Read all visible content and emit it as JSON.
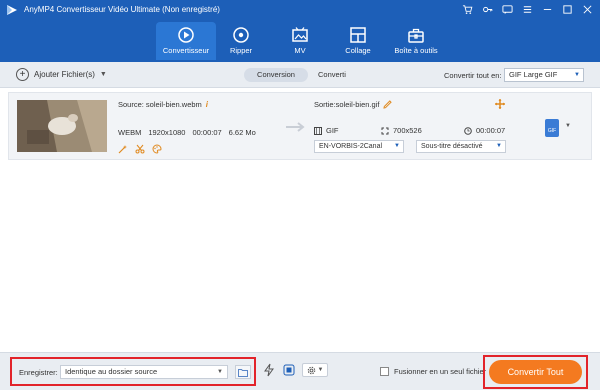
{
  "app": {
    "title": "AnyMP4 Convertisseur Vidéo Ultimate (Non enregistré)"
  },
  "window_icons": [
    "cart-icon",
    "key-icon",
    "chat-icon",
    "menu-icon",
    "minimize-icon",
    "maximize-icon",
    "close-icon"
  ],
  "nav": {
    "tabs": [
      {
        "label": "Convertisseur",
        "icon": "convert-icon",
        "active": true
      },
      {
        "label": "Ripper",
        "icon": "disc-icon",
        "active": false
      },
      {
        "label": "MV",
        "icon": "mv-icon",
        "active": false
      },
      {
        "label": "Collage",
        "icon": "collage-icon",
        "active": false
      },
      {
        "label": "Boîte à outils",
        "icon": "toolbox-icon",
        "active": false
      }
    ]
  },
  "toolbar": {
    "add_label": "Ajouter Fichier(s)",
    "tab_converting": "Conversion",
    "tab_converted": "Converti",
    "convert_all_label": "Convertir tout en:",
    "convert_all_value": "GIF Large GIF"
  },
  "file": {
    "source_label": "Source: soleil-bien.webm",
    "format": "WEBM",
    "resolution": "1920x1080",
    "duration": "00:00:07",
    "size": "6.62 Mo",
    "output_label": "Sortie:soleil-bien.gif",
    "output_format": "GIF",
    "output_resolution": "700x526",
    "output_duration": "00:00:07",
    "audio_track": "EN-VORBIS-2Canal",
    "subtitle": "Sous-titre désactivé",
    "badge_format": "GIF"
  },
  "bottom": {
    "save_label": "Enregistrer:",
    "save_path": "Identique au dossier source",
    "merge_label": "Fusionner en un seul fichier",
    "merge_checked": false,
    "convert_button": "Convertir Tout"
  },
  "colors": {
    "header": "#1d5fb8",
    "active_tab": "#2b77d4",
    "accent_orange": "#f47a20",
    "highlight_red": "#e2232a"
  }
}
